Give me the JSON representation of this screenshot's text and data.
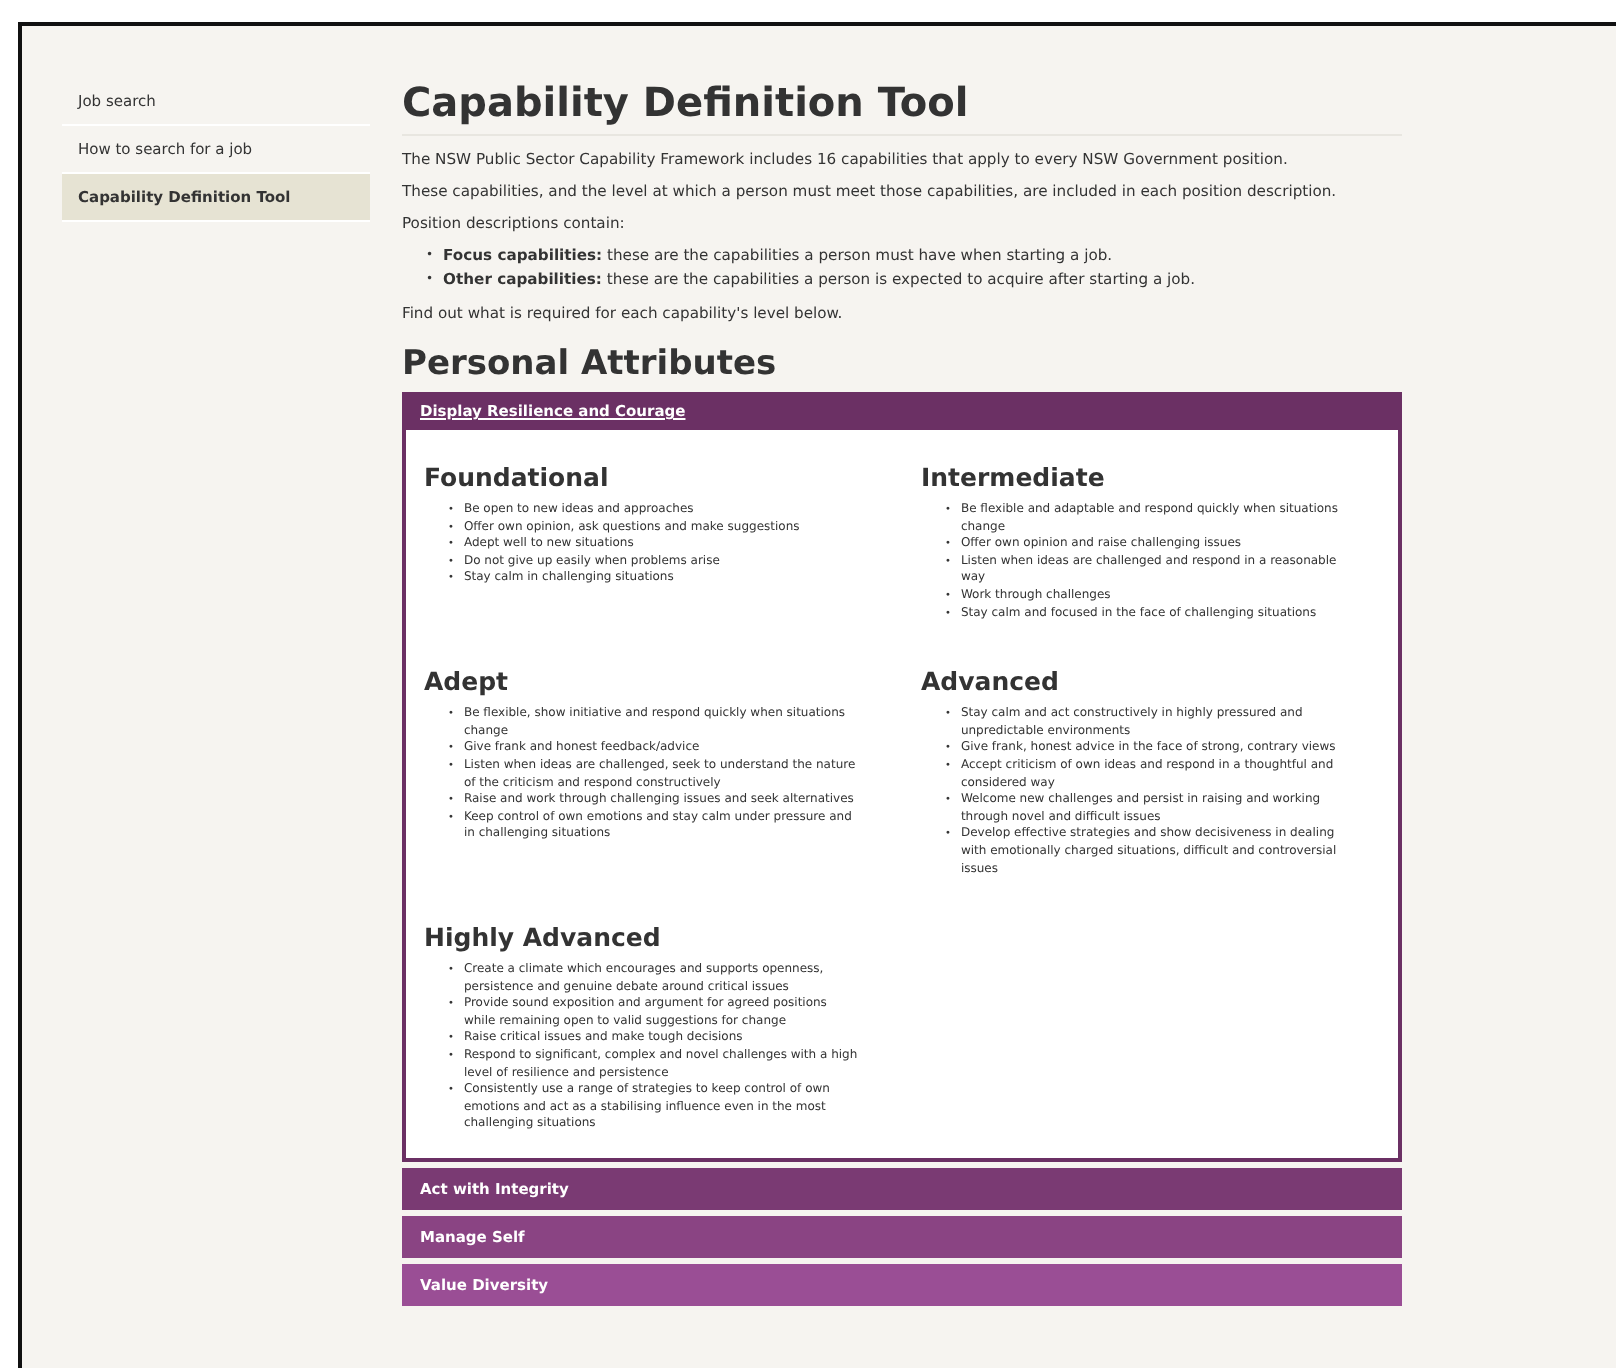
{
  "bullet_marker": "•",
  "sidebar": {
    "items": [
      {
        "label": "Job search",
        "selected": false
      },
      {
        "label": "How to search for a job",
        "selected": false
      },
      {
        "label": "Capability Definition Tool",
        "selected": true
      }
    ]
  },
  "page": {
    "title": "Capability Definition Tool",
    "intro": [
      "The NSW Public Sector Capability Framework includes 16 capabilities that apply to every NSW Government position.",
      "These capabilities, and the level at which a person must meet those capabilities, are included in each position description.",
      "Position descriptions contain:"
    ],
    "bullets": [
      "**Focus capabilities:** these are the capabilities a person must have when starting a job.",
      "**Other capabilities:** these are the capabilities a person is expected to acquire after starting a job."
    ],
    "outro": "Find out what is required for each capability's level below."
  },
  "section": {
    "title": "Personal Attributes",
    "capabilities": [
      {
        "name": "Display Resilience and Courage",
        "expanded": true,
        "levels": [
          {
            "name": "Foundational",
            "items": [
              "Be open to new ideas and approaches",
              "Offer own opinion, ask questions and make suggestions",
              "Adept well to new situations",
              "Do not give up easily when problems arise",
              "Stay calm in challenging situations"
            ]
          },
          {
            "name": "Intermediate",
            "items": [
              "Be flexible and adaptable and respond quickly when situations change",
              "Offer own opinion and raise challenging issues",
              "Listen when ideas are challenged and respond in a reasonable way",
              "Work through challenges",
              "Stay calm and focused in the face of challenging situations"
            ]
          },
          {
            "name": "Adept",
            "items": [
              "Be flexible, show initiative and respond quickly when situations change",
              "Give frank and honest feedback/advice",
              "Listen when ideas are challenged, seek to understand the nature of the criticism and respond constructively",
              "Raise and work through challenging issues and seek alternatives",
              "Keep control of own emotions and stay calm under pressure and in challenging situations"
            ]
          },
          {
            "name": "Advanced",
            "items": [
              "Stay calm and act constructively in highly pressured and unpredictable environments",
              "Give frank, honest advice in the face of strong, contrary views",
              "Accept criticism of own ideas and respond in a thoughtful and considered way",
              "Welcome new challenges and persist in raising and working through novel and difficult issues",
              "Develop effective strategies and show decisiveness in dealing with emotionally charged situations, difficult and controversial issues"
            ]
          },
          {
            "name": "Highly Advanced",
            "items": [
              "Create a climate which encourages and supports openness, persistence and genuine debate around critical issues",
              "Provide sound exposition and argument for agreed positions while remaining open to valid suggestions for change",
              "Raise critical issues and make tough decisions",
              "Respond to significant, complex and novel challenges with a high level of resilience and persistence",
              "Consistently use a range of strategies to keep control of own emotions and act as a stabilising influence even in the most challenging situations"
            ]
          }
        ]
      },
      {
        "name": "Act with Integrity",
        "expanded": false,
        "color": "#7a3a73"
      },
      {
        "name": "Manage Self",
        "expanded": false,
        "color": "#8a4483"
      },
      {
        "name": "Value Diversity",
        "expanded": false,
        "color": "#9a4e95"
      }
    ]
  }
}
